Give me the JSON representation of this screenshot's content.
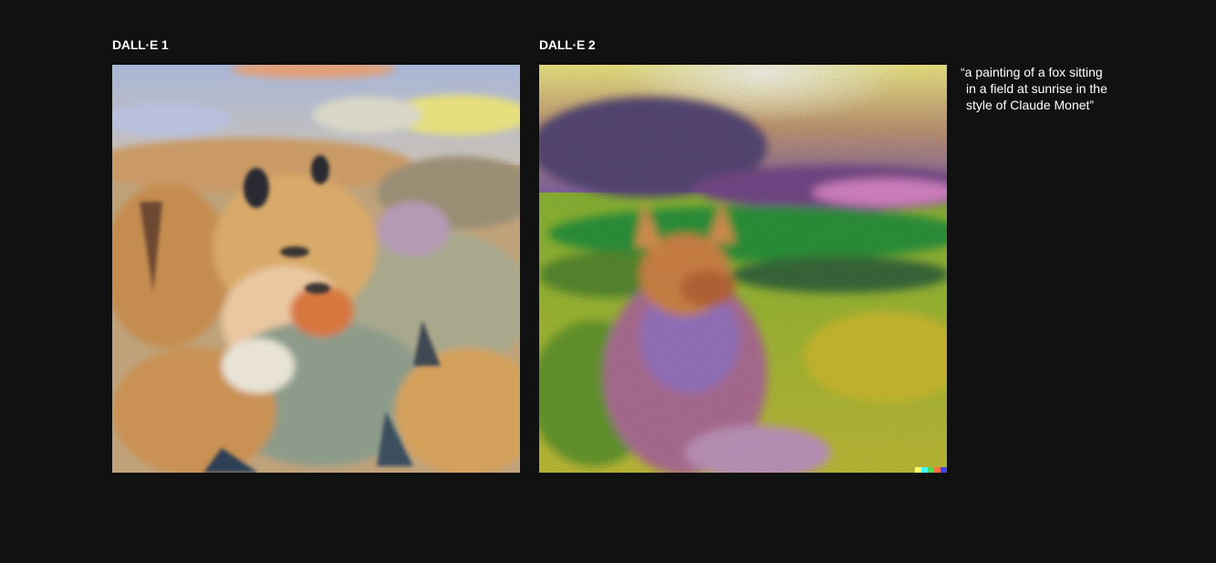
{
  "columns": [
    {
      "label": "DALL·E 1",
      "image_description_name": "fox-painting-dalle1"
    },
    {
      "label": "DALL·E 2",
      "image_description_name": "fox-painting-dalle2"
    }
  ],
  "prompt": {
    "lines": [
      "“a painting of a fox sitting",
      "in a field at sunrise in the",
      "style of Claude Monet”"
    ]
  },
  "colors": {
    "background": "#111111",
    "text": "#ffffff",
    "watermark": [
      "#ffff66",
      "#42ffff",
      "#51da4c",
      "#ff6e3c",
      "#3c46ff"
    ]
  }
}
